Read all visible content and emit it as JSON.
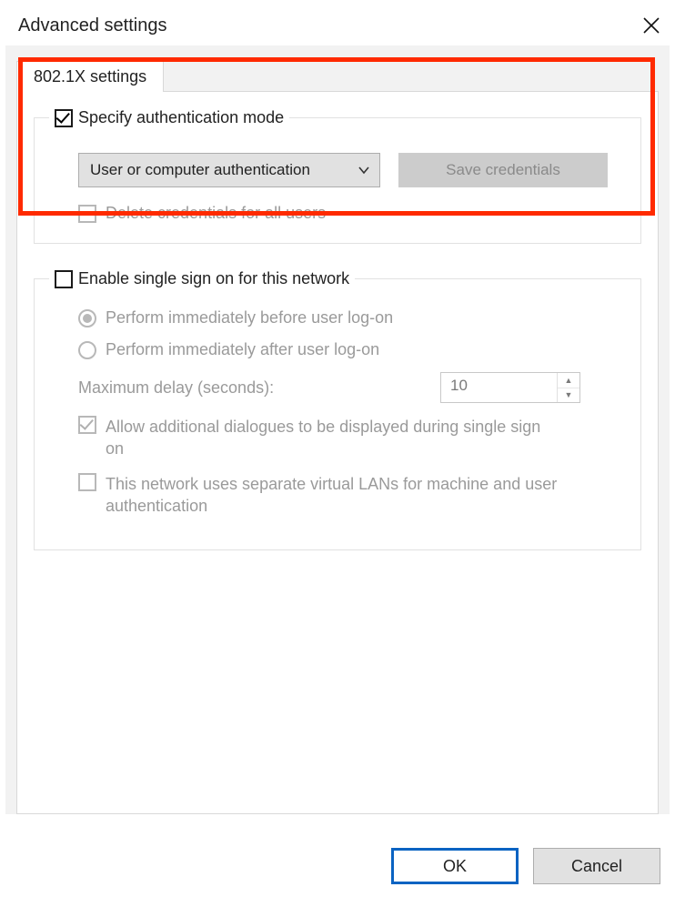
{
  "title": "Advanced settings",
  "tab_label": "802.1X settings",
  "group_auth": {
    "legend": "Specify authentication mode",
    "select_value": "User or computer authentication",
    "save_btn": "Save credentials",
    "delete_label": "Delete credentials for all users"
  },
  "group_sso": {
    "legend": "Enable single sign on for this network",
    "radio_before": "Perform immediately before user log-on",
    "radio_after": "Perform immediately after user log-on",
    "delay_label": "Maximum delay (seconds):",
    "delay_value": "10",
    "allow_dialogues": "Allow additional dialogues to be displayed during single sign on",
    "separate_vlan": "This network uses separate virtual LANs for machine and user authentication"
  },
  "footer": {
    "ok": "OK",
    "cancel": "Cancel"
  }
}
